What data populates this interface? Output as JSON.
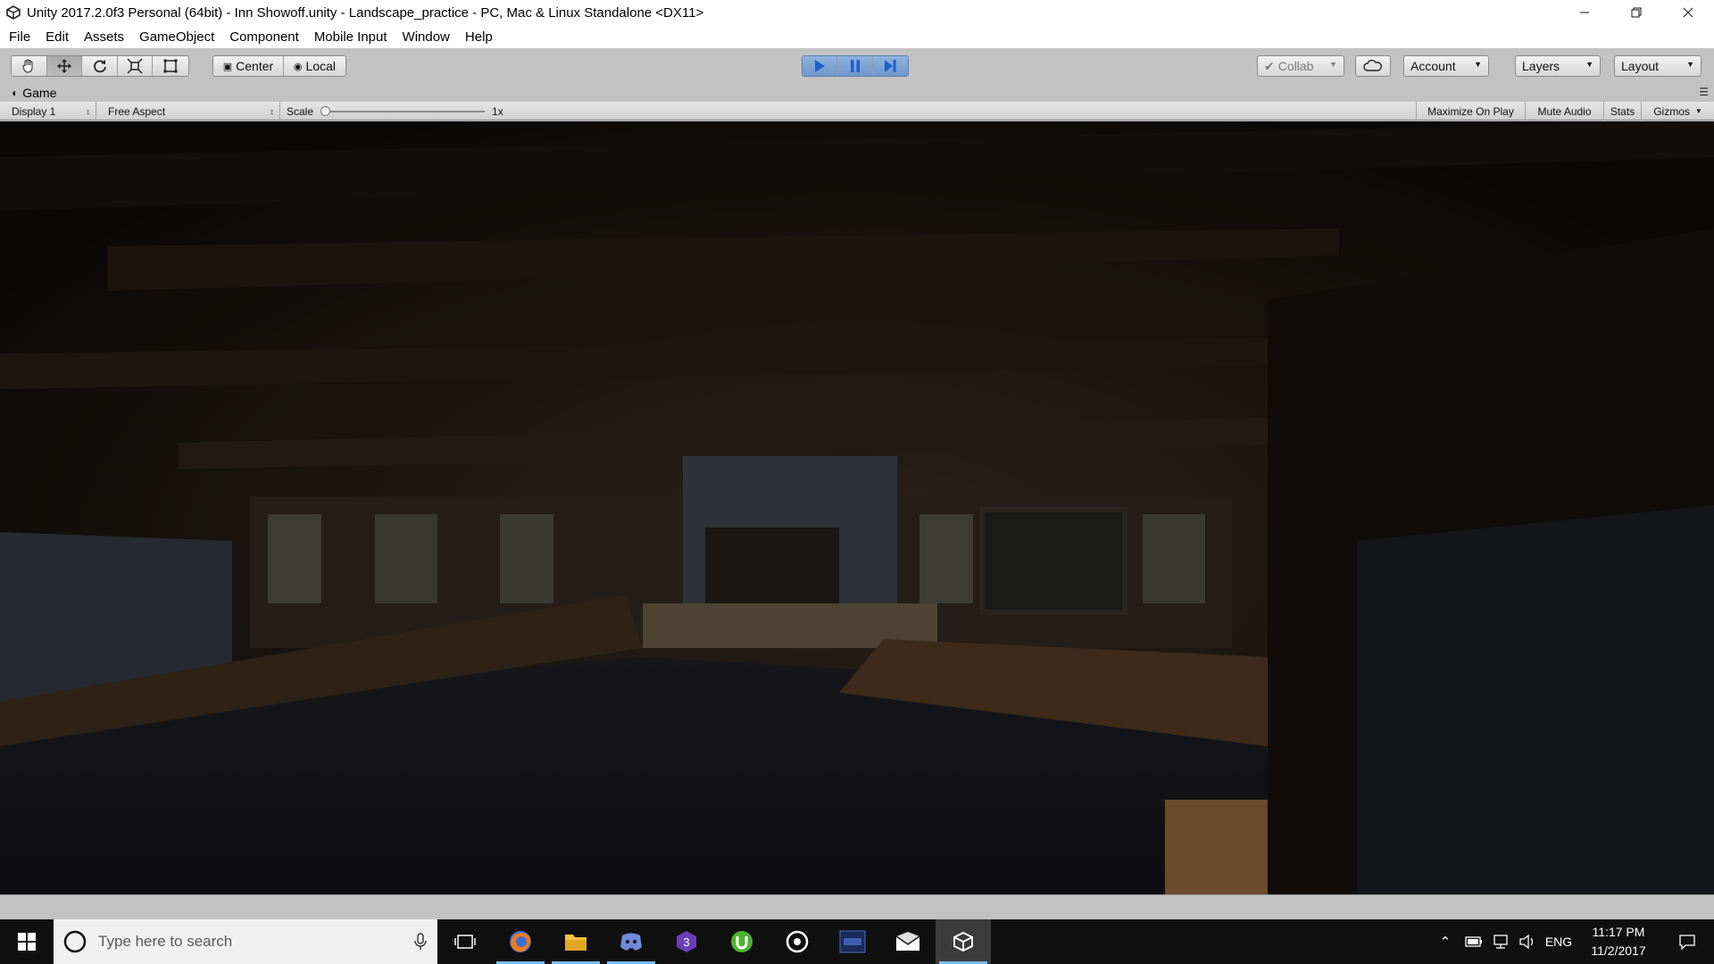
{
  "window": {
    "title": "Unity 2017.2.0f3 Personal (64bit) - Inn Showoff.unity - Landscape_practice - PC, Mac & Linux Standalone <DX11>",
    "minimize_icon": "minimize-icon",
    "maximize_icon": "restore-icon",
    "close_icon": "close-icon"
  },
  "menu": [
    "File",
    "Edit",
    "Assets",
    "GameObject",
    "Component",
    "Mobile Input",
    "Window",
    "Help"
  ],
  "toolbar": {
    "tools": [
      "hand-tool-icon",
      "move-tool-icon",
      "rotate-tool-icon",
      "scale-tool-icon",
      "rect-tool-icon"
    ],
    "active_tool": "move-tool-icon",
    "pivot_label": "Center",
    "space_label": "Local",
    "play_controls": [
      "play-icon",
      "pause-icon",
      "step-icon"
    ],
    "collab_label": "Collab",
    "account_label": "Account",
    "layers_label": "Layers",
    "layout_label": "Layout",
    "accent_color": "#2a6fd6"
  },
  "game_view": {
    "tab_label": "Game",
    "display_label": "Display 1",
    "aspect_label": "Free Aspect",
    "scale_label": "Scale",
    "scale_value": "1x",
    "scale_level": 0,
    "maximize_label": "Maximize On Play",
    "mute_label": "Mute Audio",
    "stats_label": "Stats",
    "gizmos_label": "Gizmos"
  },
  "taskbar": {
    "search_placeholder": "Type here to search",
    "apps": [
      "firefox-icon",
      "file-explorer-icon",
      "discord-icon",
      "visual-studio-icon",
      "utorrent-icon",
      "groove-music-icon",
      "application-icon",
      "mail-icon",
      "unity-icon"
    ],
    "language": "ENG",
    "time": "11:17 PM",
    "date": "11/2/2017"
  }
}
